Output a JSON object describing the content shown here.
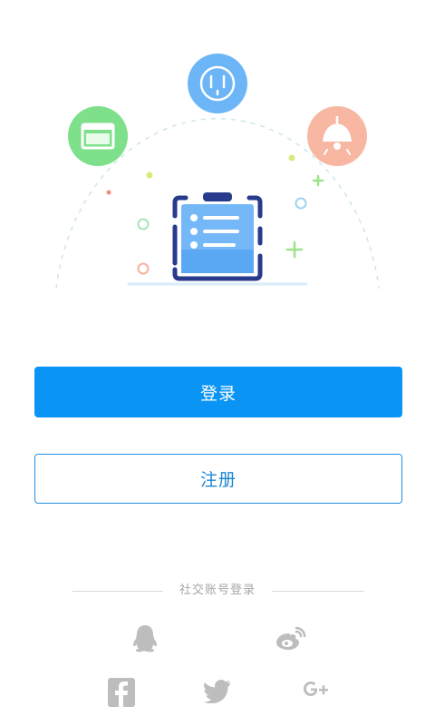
{
  "hero": {
    "illustration_name": "clipboard-checklist-illustration",
    "icons": [
      "browser-window-icon",
      "power-outlet-icon",
      "ceiling-lamp-icon",
      "clipboard-icon"
    ]
  },
  "actions": {
    "login_label": "登录",
    "register_label": "注册"
  },
  "social": {
    "title": "社交账号登录",
    "providers": [
      "qq-icon",
      "weibo-icon",
      "facebook-icon",
      "twitter-icon",
      "google-plus-icon"
    ]
  },
  "colors": {
    "primary": "#0a95f5",
    "border_blue": "#1f8fe0",
    "social_icon_gray": "#bdbdbd",
    "green_accent": "#7ee08a",
    "blue_accent": "#6cb6f7",
    "peach_accent": "#f7b7a3"
  }
}
